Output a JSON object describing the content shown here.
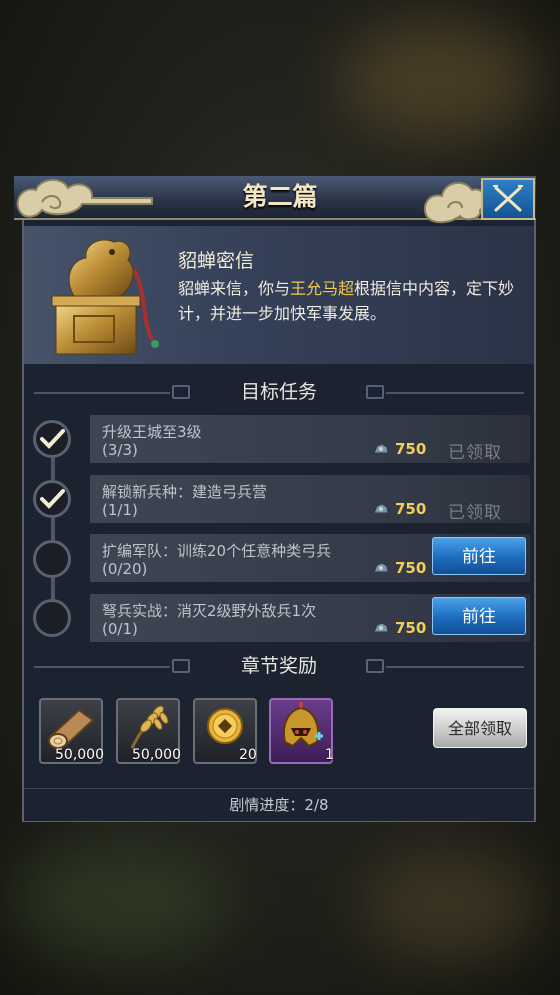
{
  "header": {
    "title": "第二篇"
  },
  "story": {
    "title": "貂蝉密信",
    "text_parts": [
      "貂蝉来信，你与",
      "王允马超",
      "根据信中内容，定下妙计，并进一步加快军事发展。"
    ]
  },
  "sections": {
    "tasks_title": "目标任务",
    "rewards_title": "章节奖励"
  },
  "tasks": [
    {
      "label": "升级王城至3级",
      "progress": "(3/3)",
      "reward": "750",
      "done": true,
      "status": "已领取"
    },
    {
      "label": "解锁新兵种：建造弓兵营",
      "progress": "(1/1)",
      "reward": "750",
      "done": true,
      "status": "已领取"
    },
    {
      "label": "扩编军队：训练20个任意种类弓兵",
      "progress": "(0/20)",
      "reward": "750",
      "done": false,
      "status": "前往"
    },
    {
      "label": "弩兵实战：消灭2级野外敌兵1次",
      "progress": "(0/1)",
      "reward": "750",
      "done": false,
      "status": "前往"
    }
  ],
  "rewards": [
    {
      "icon": "wood-log-icon",
      "count": "50,000"
    },
    {
      "icon": "wheat-icon",
      "count": "50,000"
    },
    {
      "icon": "gold-coin-icon",
      "count": "20"
    },
    {
      "icon": "golden-helmet-icon",
      "count": "1"
    }
  ],
  "claim_all_label": "全部领取",
  "footer": {
    "progress": "剧情进度：2/8"
  },
  "colors": {
    "accent_gold": "#f1cf58",
    "button_blue": "#1d6bbd",
    "panel": "#1b2330"
  }
}
